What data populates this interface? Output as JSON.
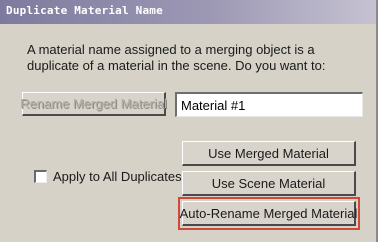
{
  "dialog": {
    "title": "Duplicate Material Name",
    "message": "A material name assigned to a merging object is a duplicate of a material in the scene. Do you want to:",
    "rename_button": "Rename Merged Material",
    "name_value": "Material #1",
    "apply_all_label": "Apply to All Duplicates:",
    "apply_all_checked": false,
    "use_merged_button": "Use Merged Material",
    "use_scene_button": "Use Scene Material",
    "auto_rename_button": "Auto-Rename Merged Material"
  }
}
